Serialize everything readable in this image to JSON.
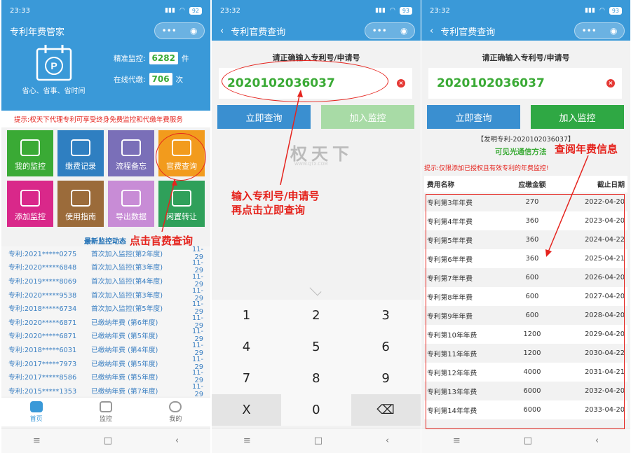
{
  "status": {
    "time1": "23:33",
    "time2": "23:32",
    "time3": "23:32",
    "battery1": "92",
    "battery2": "93",
    "battery3": "93"
  },
  "p1": {
    "title": "专利年费管家",
    "slogan": "省心、省事、省时间",
    "stat1_label": "精准监控:",
    "stat1_value": "6282",
    "stat1_unit": "件",
    "stat2_label": "在线代缴:",
    "stat2_value": "706",
    "stat2_unit": "次",
    "tip": "提示:权天下代理专利可享受终身免费监控和代缴年费服务",
    "tiles": [
      {
        "label": "我的监控",
        "color": "#3aaa35",
        "icon": "monitor-icon"
      },
      {
        "label": "缴费记录",
        "color": "#2f7fc1",
        "icon": "receipt-icon"
      },
      {
        "label": "流程备忘",
        "color": "#7a6fb8",
        "icon": "memo-icon"
      },
      {
        "label": "官费查询",
        "color": "#f29b1d",
        "icon": "fee-search-icon"
      },
      {
        "label": "添加监控",
        "color": "#d9288a",
        "icon": "calendar-add-icon"
      },
      {
        "label": "使用指南",
        "color": "#9b6b3a",
        "icon": "guide-icon"
      },
      {
        "label": "导出数据",
        "color": "#c88cd6",
        "icon": "export-icon"
      },
      {
        "label": "闲置转让",
        "color": "#2fa05a",
        "icon": "transfer-icon"
      }
    ],
    "feed_title": "最新监控动态",
    "feed": [
      [
        "专利:2021*****0275",
        "首次加入监控(第2年度)",
        "11-29"
      ],
      [
        "专利:2020*****6848",
        "首次加入监控(第3年度)",
        "11-29"
      ],
      [
        "专利:2019*****8069",
        "首次加入监控(第4年度)",
        "11-29"
      ],
      [
        "专利:2020*****9538",
        "首次加入监控(第3年度)",
        "11-29"
      ],
      [
        "专利:2018*****6734",
        "首次加入监控(第5年度)",
        "11-29"
      ],
      [
        "专利:2020*****6871",
        "已缴纳年费 (第6年度)",
        "11-29"
      ],
      [
        "专利:2020*****6871",
        "已缴纳年费 (第5年度)",
        "11-29"
      ],
      [
        "专利:2018*****6031",
        "已缴纳年费 (第4年度)",
        "11-29"
      ],
      [
        "专利:2017*****7973",
        "已缴纳年费 (第5年度)",
        "11-29"
      ],
      [
        "专利:2017*****8586",
        "已缴纳年费 (第5年度)",
        "11-29"
      ],
      [
        "专利:2015*****1353",
        "已缴纳年费 (第7年度)",
        "11-29"
      ]
    ],
    "tabs": [
      "首页",
      "监控",
      "我的"
    ],
    "annotation": "点击官费查询"
  },
  "p2": {
    "title": "专利官费查询",
    "prompt": "请正确输入专利号/申请号",
    "input_value": "2020102036037",
    "btn_query": "立即查询",
    "btn_add": "加入监控",
    "watermark": "权天下",
    "watermark_sub": "WWW.QTX.COM",
    "annotation": "输入专利号/申请号\n再点击立即查询",
    "keys": [
      "1",
      "2",
      "3",
      "4",
      "5",
      "6",
      "7",
      "8",
      "9",
      "X",
      "0",
      "⌫"
    ]
  },
  "p3": {
    "title": "专利官费查询",
    "prompt": "请正确输入专利号/申请号",
    "input_value": "2020102036037",
    "btn_query": "立即查询",
    "btn_add": "加入监控",
    "subtitle": "【发明专利-2020102036037】",
    "green_note": "可见光通信方法",
    "tip": "提示:仅限添加已授权且有效专利的年费监控!",
    "annotation": "查阅年费信息",
    "headers": [
      "费用名称",
      "应缴金额",
      "截止日期"
    ],
    "rows": [
      [
        "专利第3年年费",
        "270",
        "2022-04-20"
      ],
      [
        "专利第4年年费",
        "360",
        "2023-04-20"
      ],
      [
        "专利第5年年费",
        "360",
        "2024-04-22"
      ],
      [
        "专利第6年年费",
        "360",
        "2025-04-21"
      ],
      [
        "专利第7年年费",
        "600",
        "2026-04-20"
      ],
      [
        "专利第8年年费",
        "600",
        "2027-04-20"
      ],
      [
        "专利第9年年费",
        "600",
        "2028-04-20"
      ],
      [
        "专利第10年年费",
        "1200",
        "2029-04-20"
      ],
      [
        "专利第11年年费",
        "1200",
        "2030-04-22"
      ],
      [
        "专利第12年年费",
        "4000",
        "2031-04-21"
      ],
      [
        "专利第13年年费",
        "6000",
        "2032-04-20"
      ],
      [
        "专利第14年年费",
        "6000",
        "2033-04-20"
      ]
    ]
  },
  "colors": {
    "brand": "#3a99d8",
    "green": "#3aaa35",
    "red": "#e5231d"
  }
}
